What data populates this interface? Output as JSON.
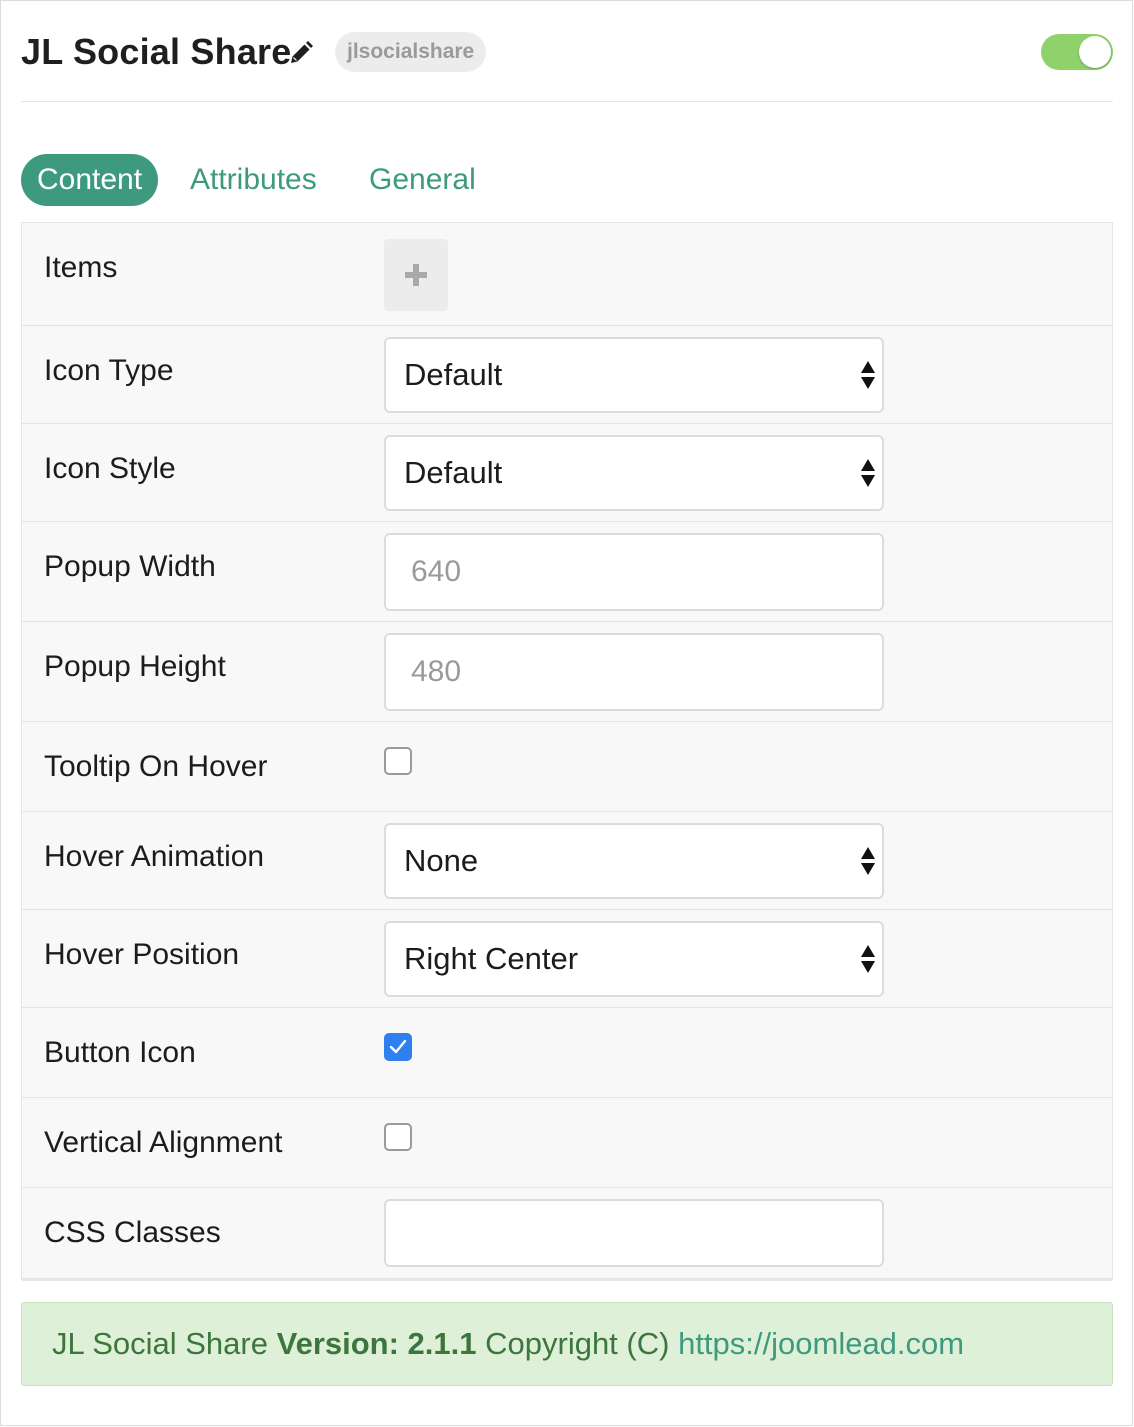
{
  "header": {
    "title": "JL Social Share",
    "alias": "jlsocialshare",
    "enabled": true
  },
  "tabs": [
    {
      "label": "Content",
      "active": true
    },
    {
      "label": "Attributes",
      "active": false
    },
    {
      "label": "General",
      "active": false
    }
  ],
  "form": {
    "items": {
      "label": "Items"
    },
    "icon_type": {
      "label": "Icon Type",
      "value": "Default"
    },
    "icon_style": {
      "label": "Icon Style",
      "value": "Default"
    },
    "popup_width": {
      "label": "Popup Width",
      "placeholder": "640",
      "value": ""
    },
    "popup_height": {
      "label": "Popup Height",
      "placeholder": "480",
      "value": ""
    },
    "tooltip_on_hover": {
      "label": "Tooltip On Hover",
      "checked": false
    },
    "hover_animation": {
      "label": "Hover Animation",
      "value": "None"
    },
    "hover_position": {
      "label": "Hover Position",
      "value": "Right Center"
    },
    "button_icon": {
      "label": "Button Icon",
      "checked": true
    },
    "vertical_alignment": {
      "label": "Vertical Alignment",
      "checked": false
    },
    "css_classes": {
      "label": "CSS Classes",
      "value": ""
    }
  },
  "footer": {
    "product": "JL Social Share",
    "version_label": "Version: 2.1.1",
    "copyright": "Copyright (C)",
    "link": "https://joomlead.com"
  },
  "colors": {
    "accent": "#3e9a7f",
    "toggle_on": "#8fd16a",
    "checkbox_checked": "#2f7ff0",
    "footer_bg": "#dff0d8"
  }
}
